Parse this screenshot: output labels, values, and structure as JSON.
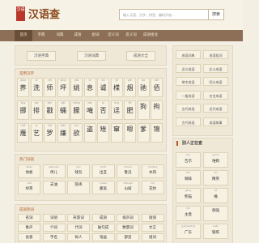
{
  "header": {
    "logo_seal": "汉语",
    "logo_text": "汉语查",
    "search_placeholder": "输入汉语、汉字、拼音、编码开始...",
    "search_button": "搜索"
  },
  "nav": [
    "首页",
    "字典",
    "词典",
    "成语",
    "组词",
    "近义词",
    "反义词",
    "成语接龙"
  ],
  "dicts": [
    "汉语字典",
    "汉语词典",
    "成语大全"
  ],
  "chars_title": "常用汉字",
  "chars": [
    {
      "py": "qiáo",
      "c": "荞"
    },
    {
      "py": "xǐ",
      "c": "洗"
    },
    {
      "py": "shī",
      "c": "师"
    },
    {
      "py": "bìng",
      "c": "坪"
    },
    {
      "py": "yáo",
      "c": "姚"
    },
    {
      "py": "xī",
      "c": "息"
    },
    {
      "py": "shì",
      "c": "谑"
    },
    {
      "py": "yè",
      "c": "楪"
    },
    {
      "py": "yān",
      "c": "烟"
    },
    {
      "py": "bó",
      "c": "驰"
    },
    {
      "py": "bǎi",
      "c": "佰"
    },
    {
      "py": "jīng",
      "c": "挪"
    },
    {
      "py": "pái",
      "c": "排"
    },
    {
      "py": "jiān",
      "c": "戳"
    },
    {
      "py": "bēi",
      "c": "蛹"
    },
    {
      "py": "méng",
      "c": "朦"
    },
    {
      "py": "yǎn",
      "c": "唵"
    },
    {
      "py": "pǐ",
      "c": "否"
    },
    {
      "py": "jìng",
      "c": "迳"
    },
    {
      "py": "fèi",
      "c": "肥"
    },
    {
      "py": "",
      "c": "狗"
    },
    {
      "py": "",
      "c": "拘"
    },
    {
      "py": "miè",
      "c": "蔑"
    },
    {
      "py": "yì",
      "c": "艺"
    },
    {
      "py": "luó",
      "c": "罗"
    },
    {
      "py": "xiān",
      "c": "嫌"
    },
    {
      "py": "chù",
      "c": "欲"
    },
    {
      "py": "",
      "c": "盗"
    },
    {
      "py": "",
      "c": "矬"
    },
    {
      "py": "",
      "c": "窜"
    },
    {
      "py": "",
      "c": "嗯"
    },
    {
      "py": "",
      "c": "爹"
    },
    {
      "py": "",
      "c": "锦"
    }
  ],
  "words_title": "热门词语",
  "words": [
    {
      "py": "dìbǎn",
      "c": "地板"
    },
    {
      "py": "wěiyuán",
      "c": "伟儿"
    },
    {
      "py": "jiǎo",
      "c": "钱包"
    },
    {
      "py": "chūtǐ",
      "c": "出丑"
    },
    {
      "py": "zhūwǔ",
      "c": "鲁迅"
    },
    {
      "py": "mùfēng",
      "c": "木风"
    },
    {
      "py": "xìtǎ",
      "c": "绿茶"
    },
    {
      "py": "",
      "c": "去油"
    },
    {
      "py": "",
      "c": "隐讳"
    },
    {
      "py": "mùtǎo",
      "c": "藤逃"
    },
    {
      "py": "shāngà",
      "c": "山坡"
    },
    {
      "py": "lìqī",
      "c": "花纹"
    }
  ],
  "idioms_title": "成语热词",
  "idioms": [
    "名词",
    "词语",
    "形容词",
    "成语",
    "拟声词",
    "短语",
    "象声",
    "介词",
    "代词",
    "破句成",
    "数量词",
    "文言",
    "会意",
    "字名",
    "拟人",
    "笔画",
    "部首",
    "组词"
  ],
  "side_links": [
    [
      "成语词典",
      "成语组词"
    ],
    [
      "近义成语",
      "反义成语"
    ],
    [
      "带字成语",
      "同义成语"
    ],
    [
      "一般成语",
      "名言成语"
    ],
    [
      "古代成语",
      "近代成语"
    ],
    [
      "古代成语",
      "成语故事"
    ]
  ],
  "people_title": "别人正在查",
  "people": [
    {
      "py": "xùn",
      "c": "告示"
    },
    {
      "py": "gǔmù",
      "c": "堆砌"
    },
    {
      "py": "tiào",
      "c": "咖啡"
    },
    {
      "py": "shì",
      "c": "精英"
    },
    {
      "py": "gēng",
      "c": "熊猫"
    },
    {
      "py": "bō",
      "c": "桶"
    },
    {
      "py": "zhī",
      "c": "主意"
    },
    {
      "py": "",
      "c": "倔强"
    },
    {
      "py": "guǎngdōng",
      "c": "广东"
    },
    {
      "py": "duǎn",
      "c": "锻炼"
    }
  ]
}
